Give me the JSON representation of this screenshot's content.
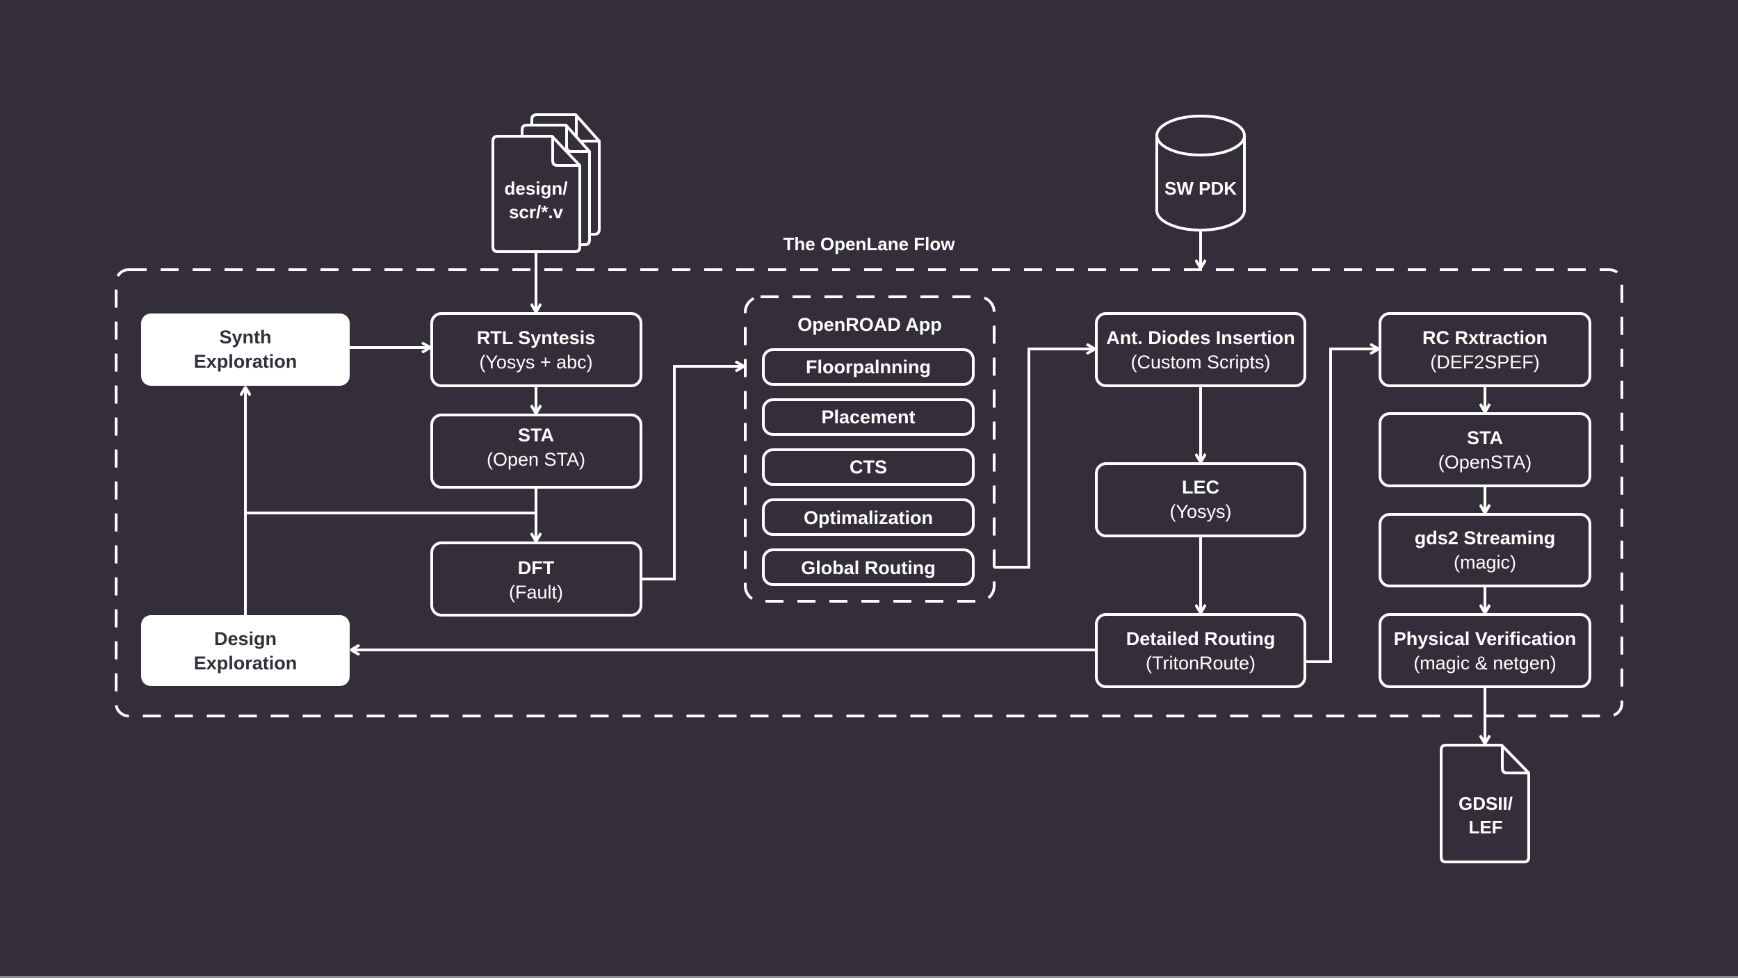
{
  "colors": {
    "background": "#332e39",
    "stroke": "#ffffff",
    "filled_box": "#ffffff",
    "filled_box_text": "#332e39"
  },
  "diagram": {
    "title": "The OpenLane Flow",
    "inputs": {
      "design_files": {
        "line1": "design/",
        "line2": "scr/*.v",
        "icon": "document-stack-icon"
      },
      "pdk": {
        "label": "SW PDK",
        "icon": "database-cylinder-icon"
      }
    },
    "output": {
      "line1": "GDSII/",
      "line2": "LEF",
      "icon": "document-icon"
    },
    "exploration": {
      "synth": {
        "line1": "Synth",
        "line2": "Exploration"
      },
      "design": {
        "line1": "Design",
        "line2": "Exploration"
      }
    },
    "synthesis_column": [
      {
        "title": "RTL Syntesis",
        "subtitle": "(Yosys + abc)"
      },
      {
        "title": "STA",
        "subtitle": "(Open STA)"
      },
      {
        "title": "DFT",
        "subtitle": "(Fault)"
      }
    ],
    "openroad": {
      "title": "OpenROAD App",
      "steps": [
        "Floorpalnning",
        "Placement",
        "CTS",
        "Optimalization",
        "Global Routing"
      ]
    },
    "routing_column": [
      {
        "title": "Ant. Diodes Insertion",
        "subtitle": "(Custom Scripts)"
      },
      {
        "title": "LEC",
        "subtitle": "(Yosys)"
      },
      {
        "title": "Detailed Routing",
        "subtitle": "(TritonRoute)"
      }
    ],
    "signoff_column": [
      {
        "title": "RC Rxtraction",
        "subtitle": "(DEF2SPEF)"
      },
      {
        "title": "STA",
        "subtitle": "(OpenSTA)"
      },
      {
        "title": "gds2 Streaming",
        "subtitle": "(magic)"
      },
      {
        "title": "Physical Verification",
        "subtitle": "(magic & netgen)"
      }
    ],
    "connections": [
      {
        "from": "design-files",
        "to": "rtl-synthesis"
      },
      {
        "from": "synth-exploration",
        "to": "rtl-synthesis"
      },
      {
        "from": "rtl-synthesis",
        "to": "sta"
      },
      {
        "from": "sta",
        "to": "dft"
      },
      {
        "from": "sta",
        "to": "synth-exploration"
      },
      {
        "from": "dft",
        "to": "openroad-app"
      },
      {
        "from": "openroad-app",
        "to": "ant-diodes-insertion"
      },
      {
        "from": "sw-pdk",
        "to": "openlane-flow"
      },
      {
        "from": "ant-diodes-insertion",
        "to": "lec"
      },
      {
        "from": "lec",
        "to": "detailed-routing"
      },
      {
        "from": "detailed-routing",
        "to": "design-exploration"
      },
      {
        "from": "detailed-routing",
        "to": "rc-extraction"
      },
      {
        "from": "rc-extraction",
        "to": "sta-opensta"
      },
      {
        "from": "sta-opensta",
        "to": "gds2-streaming"
      },
      {
        "from": "gds2-streaming",
        "to": "physical-verification"
      },
      {
        "from": "physical-verification",
        "to": "gdsii-lef"
      }
    ]
  }
}
